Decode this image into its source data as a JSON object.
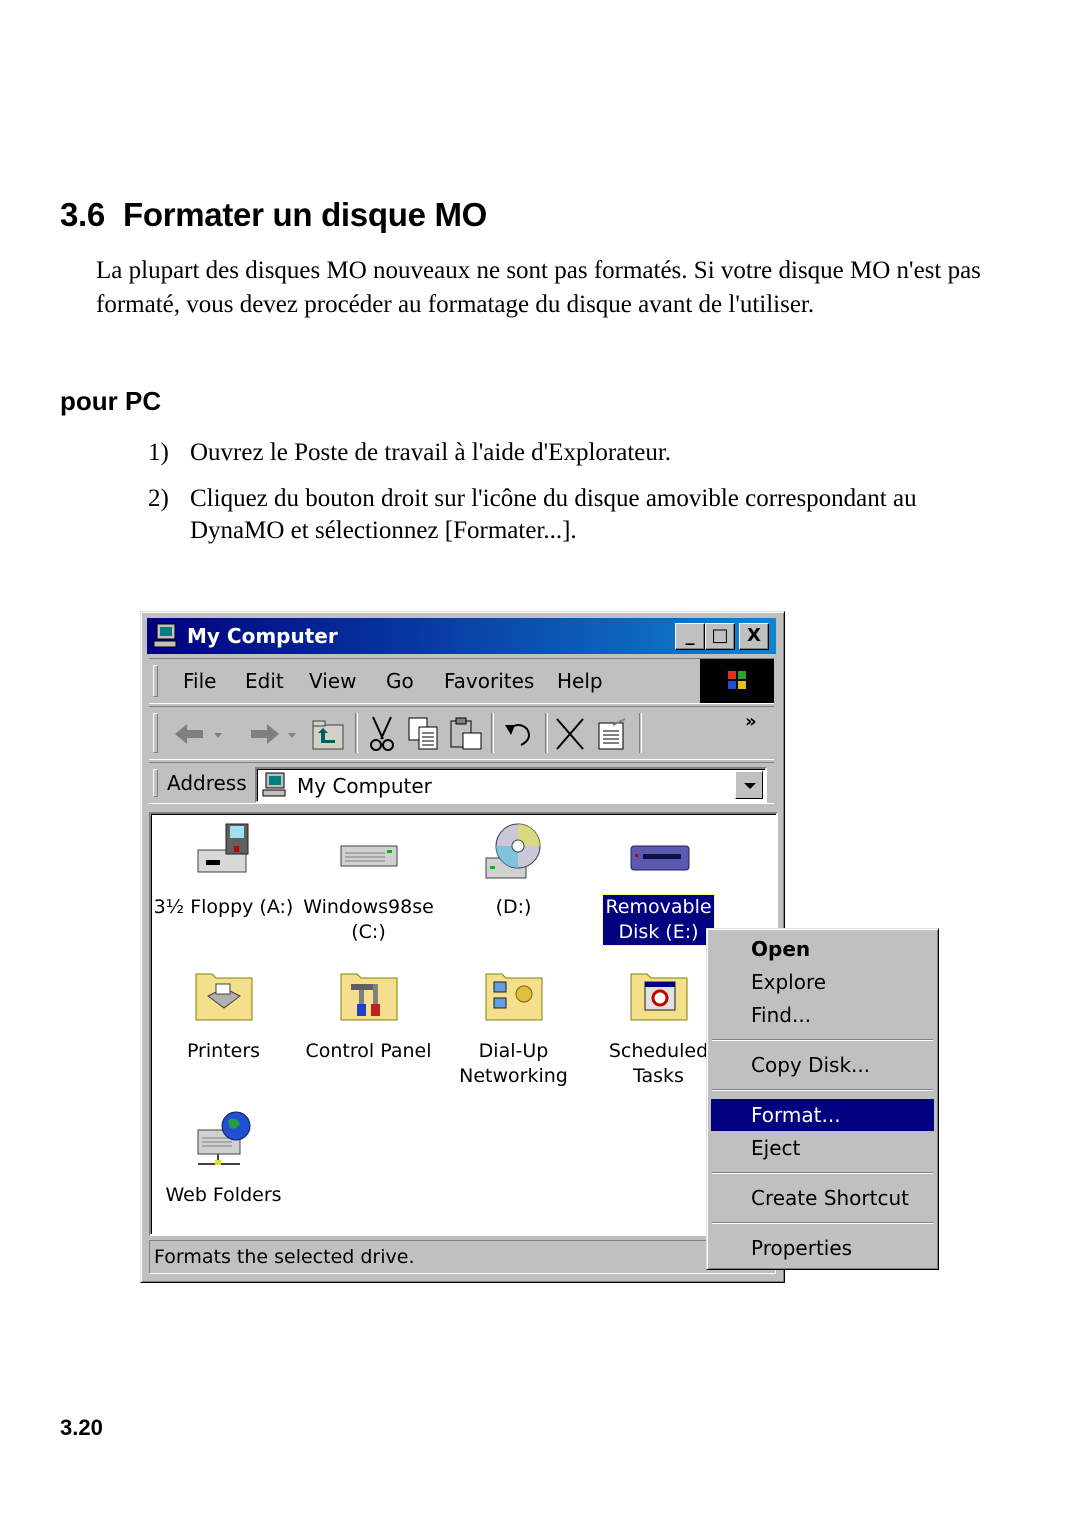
{
  "document": {
    "section_number": "3.6",
    "section_title": "Formater un disque MO",
    "intro": "La plupart des disques MO nouveaux ne sont pas formatés. Si votre disque MO n'est pas formaté, vous devez procéder au formatage du disque avant de l'utiliser.",
    "subheading": "pour PC",
    "steps": [
      {
        "number": "1)",
        "text": "Ouvrez le Poste de travail à l'aide d'Explorateur."
      },
      {
        "number": "2)",
        "text": "Cliquez du bouton droit sur l'icône du disque amovible correspondant au DynaMO et sélectionnez [Formater...]."
      }
    ],
    "page_number": "3.20"
  },
  "window": {
    "title": "My Computer",
    "controls": {
      "minimize": "_",
      "maximize": "□",
      "close": "X"
    },
    "menu": [
      {
        "label": "File",
        "accel": "F"
      },
      {
        "label": "Edit",
        "accel": "E"
      },
      {
        "label": "View",
        "accel": "V"
      },
      {
        "label": "Go",
        "accel": "G"
      },
      {
        "label": "Favorites",
        "accel": "a"
      },
      {
        "label": "Help",
        "accel": "H"
      }
    ],
    "toolbar": {
      "buttons": [
        "back",
        "forward",
        "up",
        "cut",
        "copy",
        "paste",
        "undo",
        "delete",
        "properties"
      ],
      "overflow": "»"
    },
    "address": {
      "label": "Address",
      "value": "My Computer"
    },
    "items": [
      {
        "label": "3½ Floppy (A:)",
        "icon": "floppy-drive-icon"
      },
      {
        "label": "Windows98se\n(C:)",
        "icon": "hard-drive-icon"
      },
      {
        "label": "(D:)",
        "icon": "cd-drive-icon"
      },
      {
        "label": "Removable\nDisk (E:)",
        "icon": "removable-disk-icon",
        "selected": true
      },
      {
        "label": "Printers",
        "icon": "printers-folder-icon"
      },
      {
        "label": "Control Panel",
        "icon": "control-panel-folder-icon"
      },
      {
        "label": "Dial-Up\nNetworking",
        "icon": "dialup-folder-icon"
      },
      {
        "label": "Scheduled\nTasks",
        "icon": "scheduled-tasks-folder-icon"
      },
      {
        "label": "Web Folders",
        "icon": "web-folders-icon"
      }
    ],
    "status": "Formats the selected drive."
  },
  "context_menu": {
    "items": [
      {
        "label": "Open",
        "bold": true
      },
      {
        "label": "Explore"
      },
      {
        "label": "Find..."
      },
      {
        "label": "Copy Disk..."
      },
      {
        "label": "Format...",
        "highlighted": true
      },
      {
        "label": "Eject"
      },
      {
        "label": "Create Shortcut"
      },
      {
        "label": "Properties"
      }
    ]
  },
  "colors": {
    "title_bar_start": "#000080",
    "title_bar_end": "#1084d0",
    "highlight": "#000080",
    "face": "#c0c0c0"
  }
}
